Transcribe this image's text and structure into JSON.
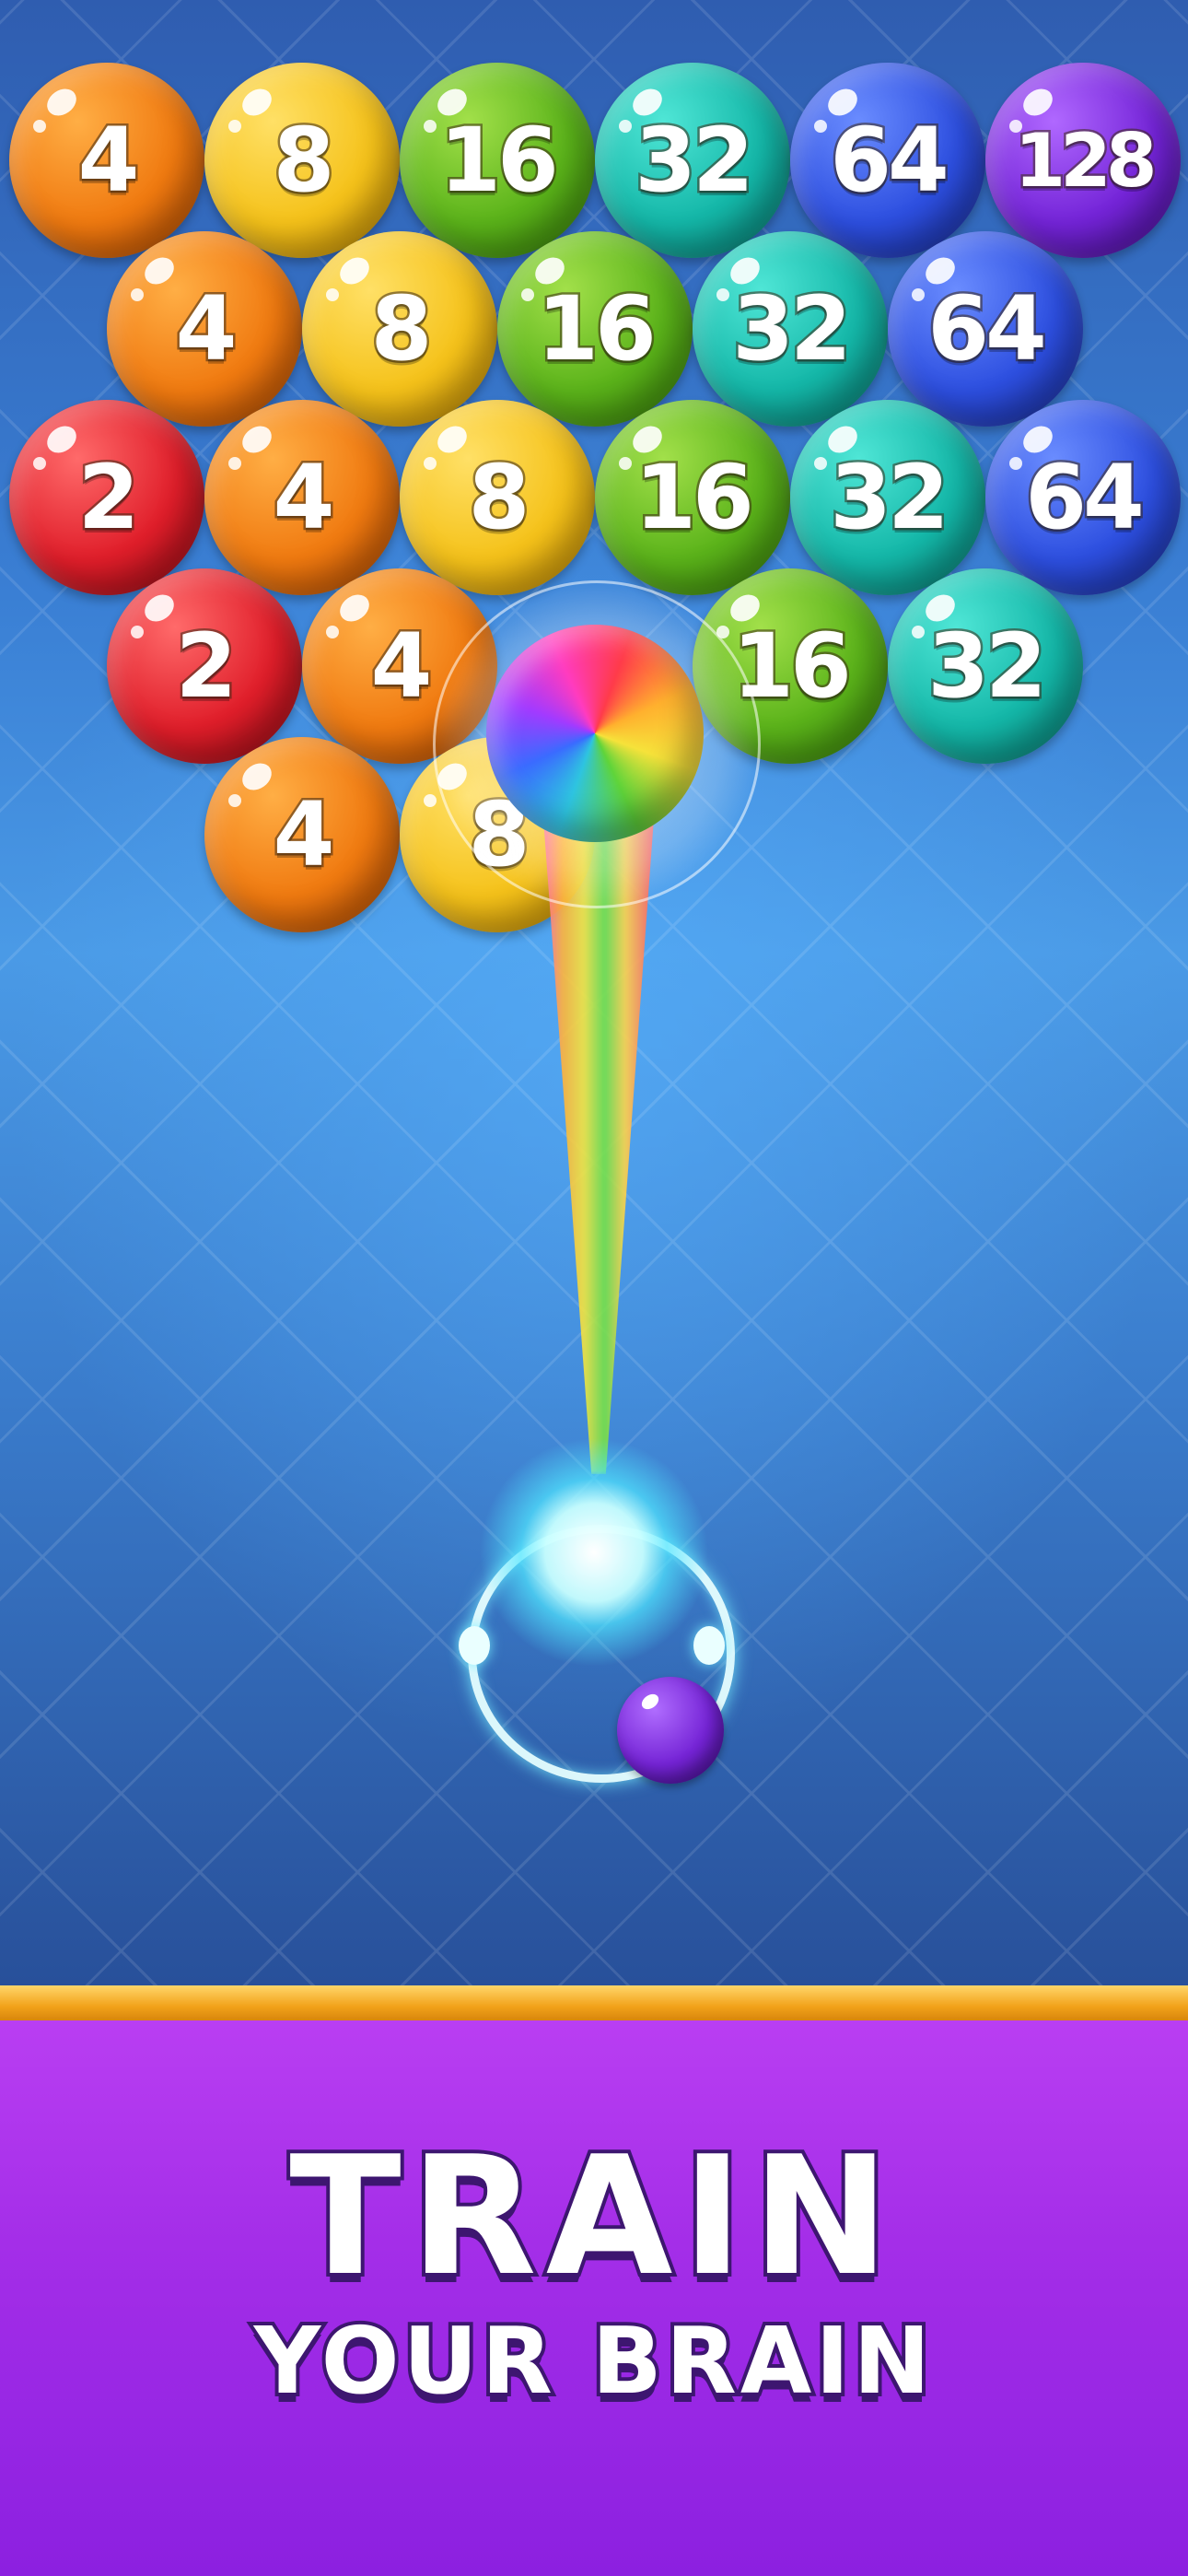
{
  "board": {
    "bubbles": [
      {
        "row": 0,
        "col": 0,
        "value": "4",
        "color": "orange"
      },
      {
        "row": 0,
        "col": 1,
        "value": "8",
        "color": "yellow"
      },
      {
        "row": 0,
        "col": 2,
        "value": "16",
        "color": "green"
      },
      {
        "row": 0,
        "col": 3,
        "value": "32",
        "color": "teal"
      },
      {
        "row": 0,
        "col": 4,
        "value": "64",
        "color": "blue"
      },
      {
        "row": 0,
        "col": 5,
        "value": "128",
        "color": "purple"
      },
      {
        "row": 1,
        "col": 0,
        "value": "4",
        "color": "orange"
      },
      {
        "row": 1,
        "col": 1,
        "value": "8",
        "color": "yellow"
      },
      {
        "row": 1,
        "col": 2,
        "value": "16",
        "color": "green"
      },
      {
        "row": 1,
        "col": 3,
        "value": "32",
        "color": "teal"
      },
      {
        "row": 1,
        "col": 4,
        "value": "64",
        "color": "blue"
      },
      {
        "row": 2,
        "col": 0,
        "value": "2",
        "color": "red"
      },
      {
        "row": 2,
        "col": 1,
        "value": "4",
        "color": "orange"
      },
      {
        "row": 2,
        "col": 2,
        "value": "8",
        "color": "yellow"
      },
      {
        "row": 2,
        "col": 3,
        "value": "16",
        "color": "green"
      },
      {
        "row": 2,
        "col": 4,
        "value": "32",
        "color": "teal"
      },
      {
        "row": 2,
        "col": 5,
        "value": "64",
        "color": "blue"
      },
      {
        "row": 3,
        "col": 0,
        "value": "2",
        "color": "red"
      },
      {
        "row": 3,
        "col": 1,
        "value": "4",
        "color": "orange"
      },
      {
        "row": 3,
        "col": 3,
        "value": "16",
        "color": "green"
      },
      {
        "row": 3,
        "col": 4,
        "value": "32",
        "color": "teal"
      },
      {
        "row": 4,
        "col": 1,
        "value": "4",
        "color": "orange"
      },
      {
        "row": 4,
        "col": 2,
        "value": "8",
        "color": "yellow"
      }
    ],
    "special_ball": "rainbow",
    "next_ball_color": "purple",
    "colors": {
      "orange": "#f07a10",
      "yellow": "#f5c21a",
      "green": "#5bb31a",
      "teal": "#14b7a8",
      "blue": "#2d4fe0",
      "purple": "#7424d8",
      "red": "#e01e2a"
    }
  },
  "banner": {
    "line1": "TRAIN",
    "line2": "YOUR BRAIN"
  }
}
